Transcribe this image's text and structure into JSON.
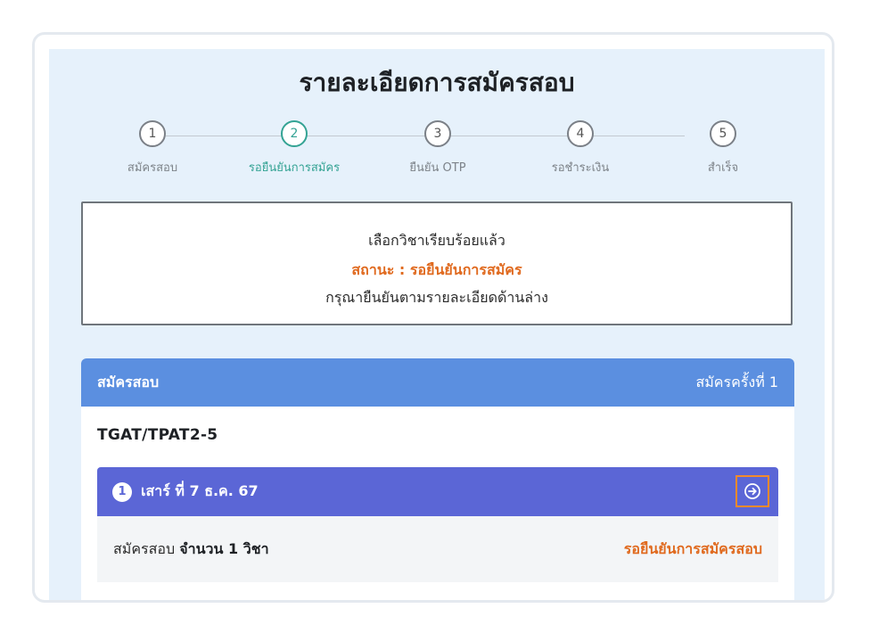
{
  "page": {
    "title": "รายละเอียดการสมัครสอบ"
  },
  "stepper": {
    "active_index": 1,
    "steps": [
      {
        "num": "1",
        "label": "สมัครสอบ"
      },
      {
        "num": "2",
        "label": "รอยืนยันการสมัคร"
      },
      {
        "num": "3",
        "label": "ยืนยัน OTP"
      },
      {
        "num": "4",
        "label": "รอชำระเงิน"
      },
      {
        "num": "5",
        "label": "สำเร็จ"
      }
    ]
  },
  "status": {
    "line1": "เลือกวิชาเรียบร้อยแล้ว",
    "line2": "สถานะ : รอยืนยันการสมัคร",
    "line3": "กรุณายืนยันตามรายละเอียดด้านล่าง"
  },
  "card": {
    "header_title": "สมัครสอบ",
    "header_count": "สมัครครั้งที่ 1",
    "subject_code": "TGAT/TPAT2-5",
    "session": {
      "num": "1",
      "date": "เสาร์ ที่ 7 ธ.ค. 67",
      "go_icon": "arrow-right-circle-icon"
    },
    "body_prefix": "สมัครสอบ",
    "body_count": "จำนวน 1 วิชา",
    "body_status": "รอยืนยันการสมัครสอบ"
  },
  "colors": {
    "accent_teal": "#34a394",
    "header_blue": "#5b8fe0",
    "session_purple": "#5b66d6",
    "status_orange": "#e06a1f"
  }
}
